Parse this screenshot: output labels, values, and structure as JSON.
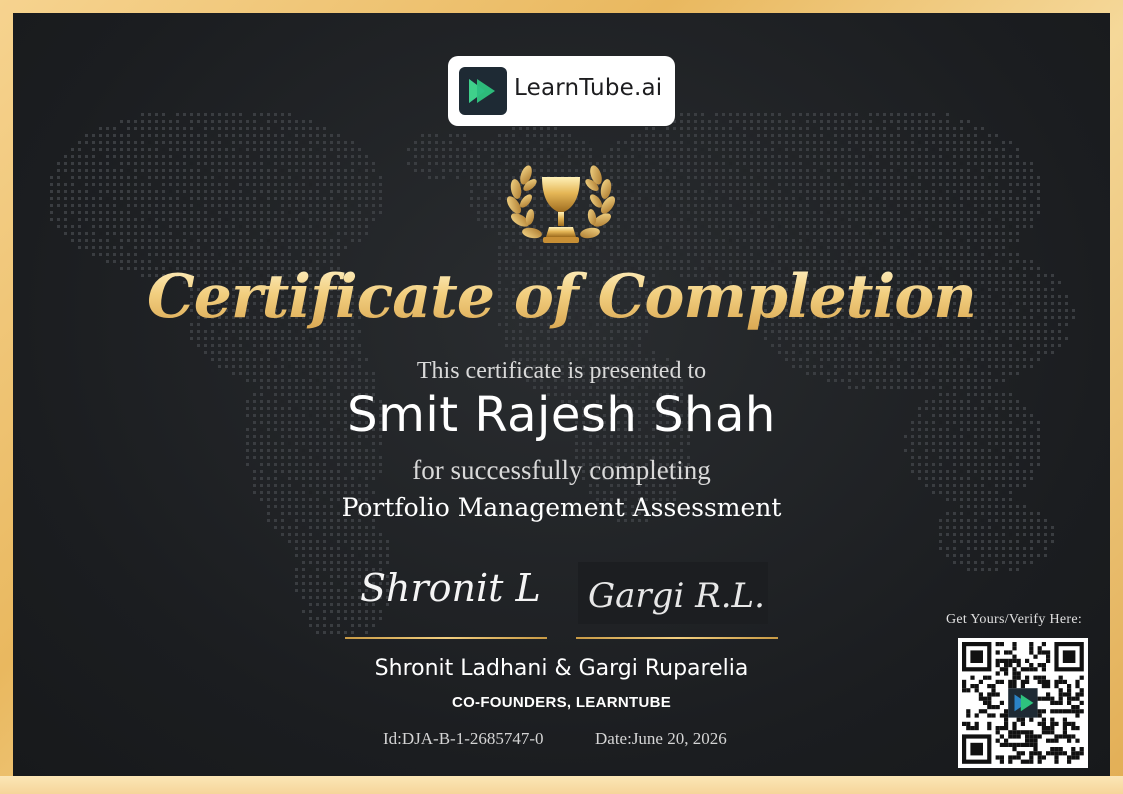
{
  "brand": {
    "name": "LearnTube.ai"
  },
  "certificate": {
    "title": "Certificate of Completion",
    "presented_text": "This certificate is presented to",
    "recipient": "Smit Rajesh Shah",
    "completing_text": "for successfully completing",
    "course": "Portfolio Management Assessment"
  },
  "signatures": {
    "sig1": "Shronit L",
    "sig2": "Gargi R.L."
  },
  "founders": {
    "names": "Shronit Ladhani & Gargi Ruparelia",
    "role": "CO-FOUNDERS, LEARNTUBE"
  },
  "meta": {
    "id": "Id:DJA-B-1-2685747-0",
    "date": "Date:June 20, 2026"
  },
  "verify": {
    "label": "Get Yours/Verify Here:"
  },
  "colors": {
    "gold": "#f0cf84",
    "border": "#f1c46e",
    "panel": "#1d1f22",
    "logo_green": "#2ec27e",
    "logo_blue": "#2b83c6"
  },
  "icons": [
    "trophy-laurel-icon",
    "play-logo-icon",
    "qr-code-icon"
  ]
}
